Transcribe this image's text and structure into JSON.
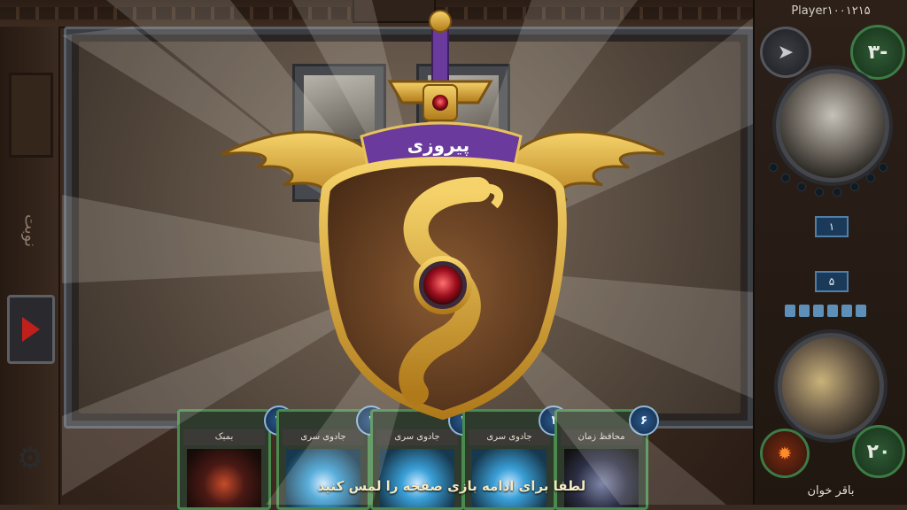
{
  "header": {
    "player_name": "Player۱۰۰۱۲۱۵"
  },
  "left_panel": {
    "turn_label": "نوبت"
  },
  "opponent": {
    "mana": "۳-",
    "board_badge": "۱"
  },
  "player": {
    "name": "باقر خوان",
    "health": "۲۰",
    "board_badge": "۵"
  },
  "hand": [
    {
      "title": "بمبک",
      "cost": "۲",
      "art": "c-dark"
    },
    {
      "title": "جادوی سری",
      "cost": "۱",
      "art": ""
    },
    {
      "title": "جادوی سری",
      "cost": "۱",
      "art": ""
    },
    {
      "title": "جادوی سری",
      "cost": "۱",
      "art": ""
    },
    {
      "title": "محافظ زمان",
      "cost": "۶",
      "art": "c-ghost"
    }
  ],
  "victory": {
    "banner": "پیروزی",
    "continue_prompt": "لطفا برای ادامه بازی صفحه را لمس کنید"
  },
  "icons": {
    "end_turn": "triangle-right-icon",
    "settings": "gear-icon",
    "opp_weapon": "arrowhead-icon",
    "player_weapon": "fire-icon"
  },
  "colors": {
    "accent_gold": "#d9a72a",
    "banner_purple": "#6a3a9c",
    "card_border": "#4b8a4e"
  }
}
